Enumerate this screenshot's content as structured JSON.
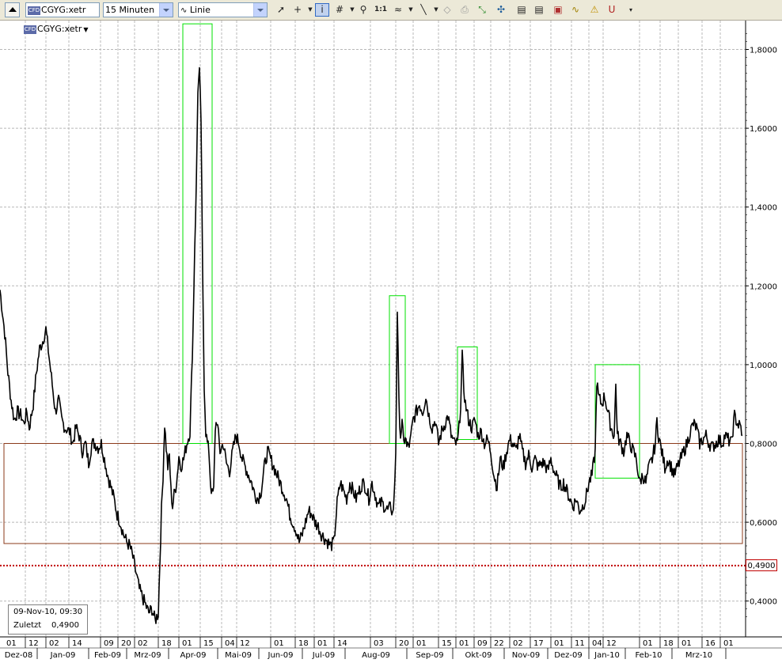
{
  "toolbar": {
    "symbol": "CGYG:xetr",
    "cfd_badge": "CFD",
    "interval": "15 Minuten",
    "chart_style": "Linie",
    "tools": [
      "cursor-icon",
      "crosshair-icon",
      "info-icon",
      "grid-icon",
      "zoom-icon",
      "one-to-one-icon",
      "wave-icon",
      "line-icon",
      "eraser-icon",
      "print-icon",
      "arrows-icon",
      "doc-icon",
      "doc2-icon",
      "doc3-icon",
      "indicator-icon",
      "warning-icon",
      "magnet-icon",
      "menu-icon"
    ]
  },
  "chart": {
    "symbol_label": "CGYG:xetr",
    "info": {
      "datetime": "09-Nov-10, 09:30",
      "last_label": "Zuletzt",
      "last_value": "0,4900"
    },
    "hline_label": "0,4900",
    "colors": {
      "price": "#000000",
      "zone": "#8b3a1a",
      "boxes": "#00e000",
      "hline": "#c00000",
      "grid": "#b8b8b8"
    }
  },
  "chart_data": {
    "type": "line",
    "ylim": [
      0.32,
      1.88
    ],
    "ytick_values": [
      0.4,
      0.6,
      0.8,
      1.0,
      1.2,
      1.4,
      1.6,
      1.8
    ],
    "ytick_labels": [
      "0,4000",
      "0,6000",
      "0,8000",
      "1,0000",
      "1,2000",
      "1,4000",
      "1,6000",
      "1,8000"
    ],
    "day_ticks": [
      "01",
      "12",
      "02",
      "14",
      "09",
      "20",
      "02",
      "18",
      "01",
      "15",
      "04",
      "12",
      "01",
      "18",
      "01",
      "14",
      "03",
      "20",
      "01",
      "15",
      "01",
      "09",
      "22",
      "02",
      "17",
      "01",
      "11",
      "04",
      "12",
      "01",
      "18",
      "01",
      "16",
      "01"
    ],
    "month_labels": [
      "Dez-08",
      "Jan-09",
      "Feb-09",
      "Mrz-09",
      "Apr-09",
      "Mai-09",
      "Jun-09",
      "Jul-09",
      "Aug-09",
      "Sep-09",
      "Okt-09",
      "Nov-09",
      "Dez-09",
      "Jan-10",
      "Feb-10",
      "Mrz-10"
    ],
    "price_points": [
      [
        0,
        1.19
      ],
      [
        6,
        1.08
      ],
      [
        10,
        0.98
      ],
      [
        14,
        0.91
      ],
      [
        18,
        0.86
      ],
      [
        22,
        0.88
      ],
      [
        27,
        0.87
      ],
      [
        30,
        0.85
      ],
      [
        34,
        0.88
      ],
      [
        37,
        0.84
      ],
      [
        42,
        0.9
      ],
      [
        46,
        0.98
      ],
      [
        50,
        1.04
      ],
      [
        54,
        1.06
      ],
      [
        58,
        1.09
      ],
      [
        62,
        1.02
      ],
      [
        66,
        0.95
      ],
      [
        70,
        0.88
      ],
      [
        74,
        0.91
      ],
      [
        78,
        0.86
      ],
      [
        82,
        0.84
      ],
      [
        88,
        0.83
      ],
      [
        92,
        0.8
      ],
      [
        96,
        0.84
      ],
      [
        100,
        0.82
      ],
      [
        104,
        0.78
      ],
      [
        108,
        0.8
      ],
      [
        112,
        0.75
      ],
      [
        116,
        0.8
      ],
      [
        120,
        0.8
      ],
      [
        124,
        0.79
      ],
      [
        128,
        0.8
      ],
      [
        132,
        0.76
      ],
      [
        136,
        0.72
      ],
      [
        140,
        0.69
      ],
      [
        144,
        0.66
      ],
      [
        148,
        0.62
      ],
      [
        152,
        0.6
      ],
      [
        156,
        0.57
      ],
      [
        160,
        0.55
      ],
      [
        164,
        0.54
      ],
      [
        168,
        0.51
      ],
      [
        172,
        0.47
      ],
      [
        176,
        0.43
      ],
      [
        180,
        0.41
      ],
      [
        184,
        0.39
      ],
      [
        188,
        0.37
      ],
      [
        192,
        0.38
      ],
      [
        196,
        0.35
      ],
      [
        200,
        0.37
      ],
      [
        202,
        0.5
      ],
      [
        204,
        0.63
      ],
      [
        206,
        0.72
      ],
      [
        208,
        0.85
      ],
      [
        210,
        0.79
      ],
      [
        212,
        0.74
      ],
      [
        214,
        0.77
      ],
      [
        216,
        0.68
      ],
      [
        218,
        0.64
      ],
      [
        220,
        0.67
      ],
      [
        222,
        0.69
      ],
      [
        224,
        0.72
      ],
      [
        226,
        0.77
      ],
      [
        228,
        0.74
      ],
      [
        232,
        0.76
      ],
      [
        236,
        0.8
      ],
      [
        240,
        0.83
      ],
      [
        242,
        0.96
      ],
      [
        244,
        1.1
      ],
      [
        246,
        1.3
      ],
      [
        248,
        1.45
      ],
      [
        250,
        1.7
      ],
      [
        252,
        1.74
      ],
      [
        254,
        1.62
      ],
      [
        256,
        1.23
      ],
      [
        258,
        0.95
      ],
      [
        260,
        0.83
      ],
      [
        262,
        0.8
      ],
      [
        264,
        0.78
      ],
      [
        266,
        0.7
      ],
      [
        268,
        0.67
      ],
      [
        270,
        0.68
      ],
      [
        272,
        0.84
      ],
      [
        274,
        0.86
      ],
      [
        276,
        0.82
      ],
      [
        278,
        0.78
      ],
      [
        282,
        0.8
      ],
      [
        286,
        0.75
      ],
      [
        290,
        0.73
      ],
      [
        294,
        0.78
      ],
      [
        298,
        0.82
      ],
      [
        302,
        0.8
      ],
      [
        306,
        0.76
      ],
      [
        310,
        0.74
      ],
      [
        314,
        0.72
      ],
      [
        318,
        0.7
      ],
      [
        322,
        0.67
      ],
      [
        326,
        0.66
      ],
      [
        330,
        0.68
      ],
      [
        334,
        0.74
      ],
      [
        338,
        0.78
      ],
      [
        342,
        0.76
      ],
      [
        346,
        0.74
      ],
      [
        350,
        0.72
      ],
      [
        354,
        0.7
      ],
      [
        358,
        0.68
      ],
      [
        362,
        0.66
      ],
      [
        366,
        0.62
      ],
      [
        370,
        0.6
      ],
      [
        374,
        0.58
      ],
      [
        378,
        0.55
      ],
      [
        382,
        0.57
      ],
      [
        386,
        0.6
      ],
      [
        390,
        0.63
      ],
      [
        394,
        0.62
      ],
      [
        398,
        0.6
      ],
      [
        402,
        0.59
      ],
      [
        406,
        0.57
      ],
      [
        410,
        0.56
      ],
      [
        414,
        0.55
      ],
      [
        418,
        0.54
      ],
      [
        422,
        0.55
      ],
      [
        426,
        0.65
      ],
      [
        430,
        0.7
      ],
      [
        434,
        0.68
      ],
      [
        438,
        0.66
      ],
      [
        442,
        0.7
      ],
      [
        446,
        0.68
      ],
      [
        450,
        0.66
      ],
      [
        454,
        0.68
      ],
      [
        458,
        0.7
      ],
      [
        462,
        0.69
      ],
      [
        466,
        0.66
      ],
      [
        470,
        0.7
      ],
      [
        474,
        0.67
      ],
      [
        478,
        0.64
      ],
      [
        482,
        0.65
      ],
      [
        486,
        0.64
      ],
      [
        490,
        0.63
      ],
      [
        494,
        0.64
      ],
      [
        496,
        0.62
      ],
      [
        498,
        0.66
      ],
      [
        500,
        0.78
      ],
      [
        502,
        1.14
      ],
      [
        504,
        0.9
      ],
      [
        506,
        0.82
      ],
      [
        508,
        0.85
      ],
      [
        510,
        0.8
      ],
      [
        512,
        0.82
      ],
      [
        514,
        0.79
      ],
      [
        518,
        0.8
      ],
      [
        522,
        0.86
      ],
      [
        526,
        0.88
      ],
      [
        530,
        0.9
      ],
      [
        534,
        0.88
      ],
      [
        538,
        0.92
      ],
      [
        542,
        0.87
      ],
      [
        546,
        0.84
      ],
      [
        550,
        0.86
      ],
      [
        554,
        0.8
      ],
      [
        558,
        0.83
      ],
      [
        562,
        0.85
      ],
      [
        566,
        0.87
      ],
      [
        570,
        0.82
      ],
      [
        574,
        0.8
      ],
      [
        578,
        0.8
      ],
      [
        580,
        0.84
      ],
      [
        582,
        0.9
      ],
      [
        584,
        1.02
      ],
      [
        586,
        0.94
      ],
      [
        588,
        0.9
      ],
      [
        592,
        0.86
      ],
      [
        596,
        0.84
      ],
      [
        600,
        0.86
      ],
      [
        604,
        0.82
      ],
      [
        608,
        0.83
      ],
      [
        612,
        0.8
      ],
      [
        616,
        0.81
      ],
      [
        620,
        0.78
      ],
      [
        624,
        0.72
      ],
      [
        628,
        0.69
      ],
      [
        632,
        0.76
      ],
      [
        636,
        0.74
      ],
      [
        640,
        0.78
      ],
      [
        644,
        0.81
      ],
      [
        648,
        0.8
      ],
      [
        652,
        0.78
      ],
      [
        656,
        0.82
      ],
      [
        660,
        0.78
      ],
      [
        664,
        0.75
      ],
      [
        668,
        0.77
      ],
      [
        672,
        0.74
      ],
      [
        676,
        0.76
      ],
      [
        680,
        0.74
      ],
      [
        684,
        0.75
      ],
      [
        688,
        0.75
      ],
      [
        692,
        0.73
      ],
      [
        696,
        0.76
      ],
      [
        700,
        0.73
      ],
      [
        704,
        0.71
      ],
      [
        708,
        0.69
      ],
      [
        712,
        0.7
      ],
      [
        716,
        0.68
      ],
      [
        720,
        0.66
      ],
      [
        724,
        0.64
      ],
      [
        728,
        0.66
      ],
      [
        732,
        0.63
      ],
      [
        736,
        0.64
      ],
      [
        740,
        0.66
      ],
      [
        744,
        0.7
      ],
      [
        748,
        0.72
      ],
      [
        752,
        0.78
      ],
      [
        754,
        0.96
      ],
      [
        756,
        0.92
      ],
      [
        760,
        0.9
      ],
      [
        764,
        0.92
      ],
      [
        768,
        0.88
      ],
      [
        772,
        0.84
      ],
      [
        776,
        0.82
      ],
      [
        778,
        0.95
      ],
      [
        780,
        0.82
      ],
      [
        784,
        0.8
      ],
      [
        788,
        0.78
      ],
      [
        792,
        0.82
      ],
      [
        796,
        0.8
      ],
      [
        800,
        0.78
      ],
      [
        804,
        0.76
      ],
      [
        808,
        0.7
      ],
      [
        812,
        0.72
      ],
      [
        816,
        0.7
      ],
      [
        820,
        0.74
      ],
      [
        824,
        0.76
      ],
      [
        828,
        0.8
      ],
      [
        830,
        0.86
      ],
      [
        832,
        0.82
      ],
      [
        836,
        0.78
      ],
      [
        840,
        0.74
      ],
      [
        844,
        0.76
      ],
      [
        848,
        0.74
      ],
      [
        852,
        0.72
      ],
      [
        856,
        0.74
      ],
      [
        860,
        0.76
      ],
      [
        864,
        0.78
      ],
      [
        868,
        0.8
      ],
      [
        872,
        0.83
      ],
      [
        876,
        0.85
      ],
      [
        880,
        0.84
      ],
      [
        884,
        0.8
      ],
      [
        888,
        0.81
      ],
      [
        892,
        0.82
      ],
      [
        896,
        0.8
      ],
      [
        900,
        0.79
      ],
      [
        904,
        0.8
      ],
      [
        908,
        0.81
      ],
      [
        912,
        0.8
      ],
      [
        916,
        0.82
      ],
      [
        920,
        0.81
      ],
      [
        924,
        0.8
      ],
      [
        928,
        0.87
      ],
      [
        932,
        0.85
      ],
      [
        936,
        0.84
      ],
      [
        938,
        0.82
      ]
    ],
    "horizontal_line": 0.49,
    "zone_range": [
      0.546,
      0.8
    ],
    "highlight_ranges": [
      [
        0.8,
        1.865
      ],
      [
        0.8,
        1.175
      ],
      [
        0.81,
        1.045
      ],
      [
        0.712,
        1.0
      ]
    ]
  }
}
